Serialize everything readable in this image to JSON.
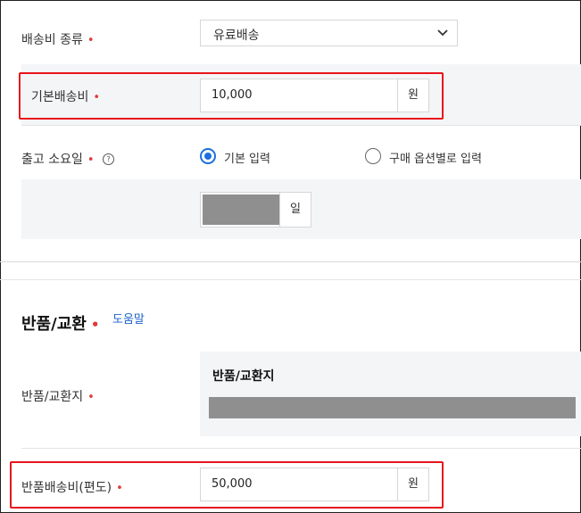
{
  "shipping_fee_type": {
    "label": "배송비 종류",
    "required_mark": "•",
    "selected": "유료배송"
  },
  "base_shipping_fee": {
    "label": "기본배송비",
    "required_mark": "•",
    "value": "10,000",
    "unit": "원"
  },
  "dispatch_days": {
    "label": "출고 소요일",
    "required_mark": "•",
    "help_icon": "?",
    "options": [
      {
        "label": "기본 입력",
        "selected": true
      },
      {
        "label": "구매 옵션별로 입력",
        "selected": false
      }
    ],
    "unit": "일"
  },
  "return_section": {
    "title": "반품/교환",
    "required_mark": "•",
    "help_link": "도움말"
  },
  "return_address": {
    "label": "반품/교환지",
    "required_mark": "•",
    "card_title": "반품/교환지"
  },
  "return_shipping_fee": {
    "label": "반품배송비(편도)",
    "required_mark": "•",
    "value": "50,000",
    "unit": "원"
  },
  "colors": {
    "required": "#e03a3a",
    "accent": "#1b6fe0",
    "highlight": "#e8141c",
    "link": "#1e63c9"
  }
}
